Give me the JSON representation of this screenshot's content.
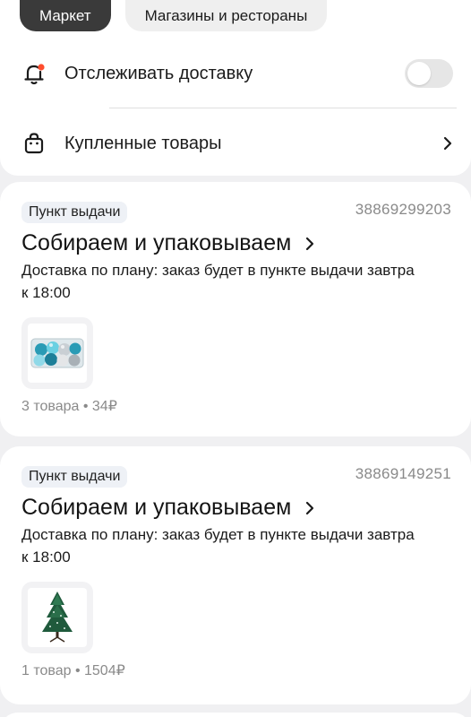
{
  "tabs": [
    {
      "label": "Маркет",
      "active": true
    },
    {
      "label": "Магазины и рестораны",
      "active": false
    }
  ],
  "track": {
    "label": "Отслеживать доставку",
    "toggle_on": false
  },
  "purchased": {
    "label": "Купленные товары"
  },
  "orders": [
    {
      "badge": "Пункт выдачи",
      "order_id": "38869299203",
      "status": "Собираем и упаковываем",
      "desc_line1": "Доставка по плану: заказ будет в пункте выдачи завтра",
      "desc_line2": "к 18:00",
      "product_icon": "ornaments-box-icon",
      "summary": "3 товара • 34₽"
    },
    {
      "badge": "Пункт выдачи",
      "order_id": "38869149251",
      "status": "Собираем и упаковываем",
      "desc_line1": "Доставка по плану: заказ будет в пункте выдачи завтра",
      "desc_line2": "к 18:00",
      "product_icon": "christmas-tree-icon",
      "summary": "1 товар • 1504₽"
    }
  ],
  "colors": {
    "background": "#f0f0f2",
    "active_tab": "#3a3a3a",
    "notify_dot": "#ff4d2e",
    "secondary_text": "#8a8a8a"
  }
}
